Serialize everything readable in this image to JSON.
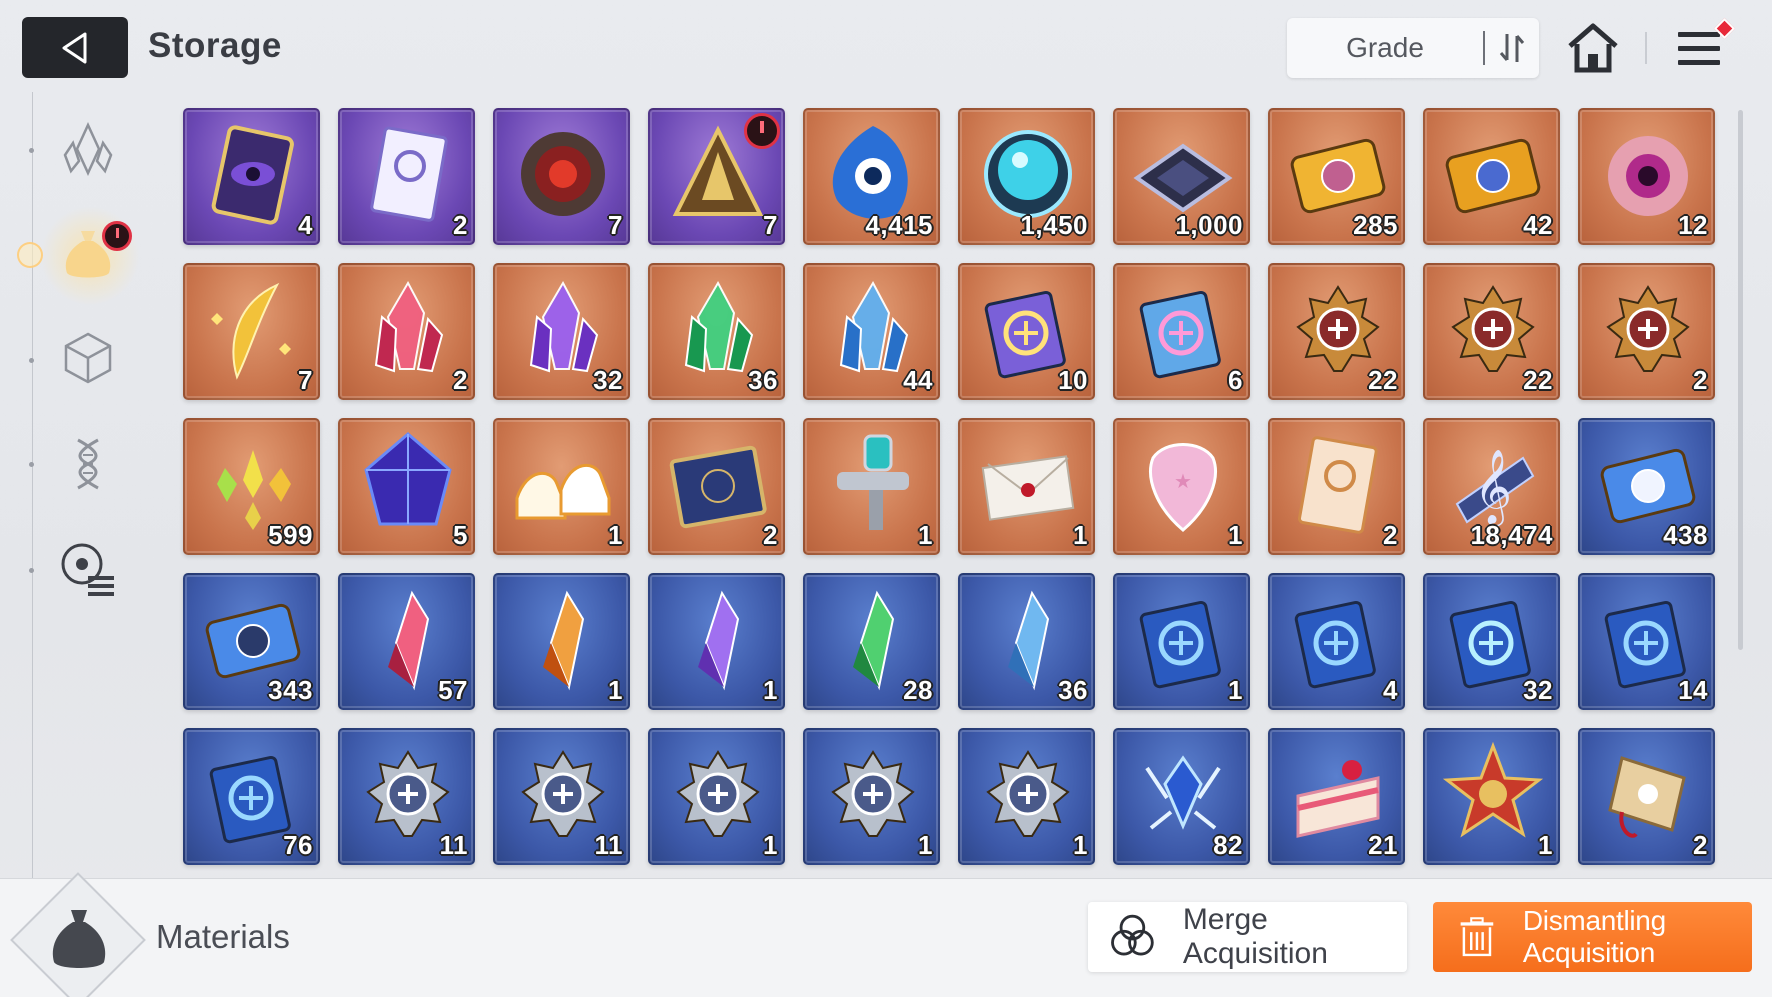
{
  "header": {
    "back_icon": "back-arrow-icon",
    "title": "Storage",
    "sort_label": "Grade",
    "sort_icon": "sort-order-icon",
    "home_icon": "home-icon",
    "menu_icon": "hamburger-menu-icon"
  },
  "sidebar": {
    "tabs": [
      {
        "icon": "crystal-icon",
        "active": false
      },
      {
        "icon": "material-pouch-icon",
        "active": true
      },
      {
        "icon": "cube-icon",
        "active": false
      },
      {
        "icon": "dna-icon",
        "active": false
      },
      {
        "icon": "core-list-icon",
        "active": false
      }
    ]
  },
  "items": [
    {
      "bg": "purple",
      "icon": "dark-eye-card",
      "count": "4"
    },
    {
      "bg": "purple",
      "icon": "emblem-booklet",
      "count": "2"
    },
    {
      "bg": "purple",
      "icon": "dark-skull-orb",
      "count": "7"
    },
    {
      "bg": "purple",
      "icon": "golden-pyramid",
      "count": "7",
      "timer": true
    },
    {
      "bg": "orange",
      "icon": "blue-flame-eye",
      "count": "4,415"
    },
    {
      "bg": "orange",
      "icon": "cyan-sphere",
      "count": "1,450"
    },
    {
      "bg": "orange",
      "icon": "data-chip",
      "count": "1,000"
    },
    {
      "bg": "orange",
      "icon": "gold-ticket-portrait",
      "count": "285"
    },
    {
      "bg": "orange",
      "icon": "gold-ticket-star",
      "count": "42"
    },
    {
      "bg": "orange",
      "icon": "purple-eye-flesh",
      "count": "12"
    },
    {
      "bg": "orange",
      "icon": "golden-feather",
      "count": "7"
    },
    {
      "bg": "orange",
      "icon": "red-crystal",
      "count": "2"
    },
    {
      "bg": "orange",
      "icon": "purple-crystal",
      "count": "32"
    },
    {
      "bg": "orange",
      "icon": "green-crystal",
      "count": "36"
    },
    {
      "bg": "orange",
      "icon": "blue-crystal",
      "count": "44"
    },
    {
      "bg": "orange",
      "icon": "holo-book-swords",
      "count": "10"
    },
    {
      "bg": "orange",
      "icon": "holo-book-wings",
      "count": "6"
    },
    {
      "bg": "orange",
      "icon": "gold-medal-sword",
      "count": "22"
    },
    {
      "bg": "orange",
      "icon": "gold-medal-shield",
      "count": "22"
    },
    {
      "bg": "orange",
      "icon": "gold-medal-bolt",
      "count": "2"
    },
    {
      "bg": "orange",
      "icon": "gold-shards",
      "count": "599"
    },
    {
      "bg": "orange",
      "icon": "dark-gem",
      "count": "5"
    },
    {
      "bg": "orange",
      "icon": "sneakers",
      "count": "1"
    },
    {
      "bg": "orange",
      "icon": "star-map-book",
      "count": "2"
    },
    {
      "bg": "orange",
      "icon": "spray-gun",
      "count": "1"
    },
    {
      "bg": "orange",
      "icon": "sealed-letter",
      "count": "1"
    },
    {
      "bg": "orange",
      "icon": "guitar-pick",
      "count": "1"
    },
    {
      "bg": "orange",
      "icon": "orange-booklet",
      "count": "2"
    },
    {
      "bg": "orange",
      "icon": "music-clef",
      "count": "18,474"
    },
    {
      "bg": "blue",
      "icon": "blue-ticket-portrait",
      "count": "438"
    },
    {
      "bg": "blue",
      "icon": "blue-ticket-star",
      "count": "343"
    },
    {
      "bg": "blue",
      "icon": "red-shard",
      "count": "57"
    },
    {
      "bg": "blue",
      "icon": "orange-shard",
      "count": "1"
    },
    {
      "bg": "blue",
      "icon": "purple-shard",
      "count": "1"
    },
    {
      "bg": "blue",
      "icon": "green-shard",
      "count": "28"
    },
    {
      "bg": "blue",
      "icon": "blue-shard",
      "count": "36"
    },
    {
      "bg": "blue",
      "icon": "blue-book-shield",
      "count": "1"
    },
    {
      "bg": "blue",
      "icon": "blue-book-core",
      "count": "4"
    },
    {
      "bg": "blue",
      "icon": "blue-book-wings",
      "count": "32"
    },
    {
      "bg": "blue",
      "icon": "blue-book-bolt",
      "count": "14"
    },
    {
      "bg": "blue",
      "icon": "blue-book-atom",
      "count": "76"
    },
    {
      "bg": "blue",
      "icon": "silver-medal-sword",
      "count": "11"
    },
    {
      "bg": "blue",
      "icon": "silver-medal-shield",
      "count": "11"
    },
    {
      "bg": "blue",
      "icon": "silver-medal-x",
      "count": "1"
    },
    {
      "bg": "blue",
      "icon": "silver-medal-bolt",
      "count": "1"
    },
    {
      "bg": "blue",
      "icon": "silver-medal-atom",
      "count": "1"
    },
    {
      "bg": "blue",
      "icon": "ice-feather-crystal",
      "count": "82"
    },
    {
      "bg": "blue",
      "icon": "strawberry-cake",
      "count": "21"
    },
    {
      "bg": "blue",
      "icon": "red-star-medal",
      "count": "1"
    },
    {
      "bg": "blue",
      "icon": "clover-tag",
      "count": "2"
    }
  ],
  "footer": {
    "category_icon": "material-pouch-icon",
    "category_label": "Materials",
    "merge_label": "Merge Acquisition",
    "merge_icon": "merge-circles-icon",
    "dismantle_label": "Dismantling Acquisition",
    "dismantle_icon": "trash-icon"
  },
  "colors": {
    "accent_orange": "#f56e1c",
    "tile_orange": "#c9744c",
    "tile_purple": "#6b48b4",
    "tile_blue": "#3c58a8",
    "alert_red": "#e03245"
  }
}
